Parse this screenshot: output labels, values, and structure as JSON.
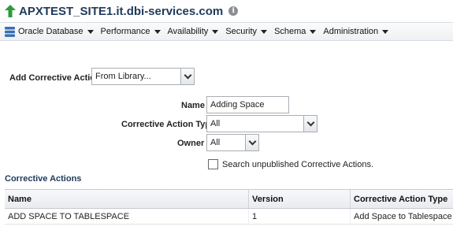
{
  "header": {
    "title": "APXTEST_SITE1.it.dbi-services.com",
    "info_icon": "info-icon",
    "status_icon": "up-arrow-icon",
    "colors": {
      "status": "#2e9a3a",
      "title": "#1f3a5a"
    }
  },
  "menubar": {
    "items": [
      {
        "label": "Oracle Database",
        "icon": "database-icon"
      },
      {
        "label": "Performance"
      },
      {
        "label": "Availability"
      },
      {
        "label": "Security"
      },
      {
        "label": "Schema"
      },
      {
        "label": "Administration"
      }
    ]
  },
  "form": {
    "add_corrective_action": {
      "label": "Add Corrective Action",
      "value": "From Library..."
    },
    "name": {
      "label": "Name",
      "value": "Adding Space"
    },
    "corrective_action_type": {
      "label": "Corrective Action Type",
      "value": "All"
    },
    "owner": {
      "label": "Owner",
      "value": "All"
    },
    "search_unpublished": {
      "label": "Search unpublished Corrective Actions.",
      "checked": false
    }
  },
  "corrective_actions": {
    "section_title": "Corrective Actions",
    "columns": [
      "Name",
      "Version",
      "Corrective Action Type"
    ],
    "rows": [
      [
        "ADD SPACE TO TABLESPACE",
        "1",
        "Add Space to Tablespace"
      ]
    ]
  }
}
